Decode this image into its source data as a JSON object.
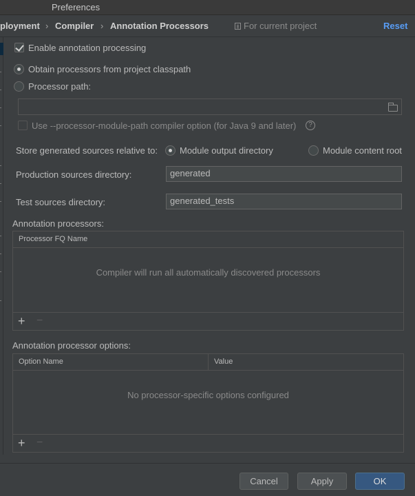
{
  "window": {
    "title": "Preferences"
  },
  "breadcrumb": {
    "items": [
      "ployment",
      "Compiler",
      "Annotation Processors"
    ],
    "scope": "For current project",
    "reset_label": "Reset"
  },
  "form": {
    "enable_processing": {
      "label": "Enable annotation processing",
      "checked": true
    },
    "source": {
      "classpath_label": "Obtain processors from project classpath",
      "classpath_selected": true,
      "path_label": "Processor path:",
      "path_value": ""
    },
    "module_path_option": {
      "label": "Use --processor-module-path compiler option (for Java 9 and later)",
      "checked": false,
      "help": "?"
    },
    "store_relative": {
      "label": "Store generated sources relative to:",
      "options": [
        "Module output directory",
        "Module content root"
      ],
      "selected": "Module output directory"
    },
    "production_dir": {
      "label": "Production sources directory:",
      "value": "generated"
    },
    "test_dir": {
      "label": "Test sources directory:",
      "value": "generated_tests"
    }
  },
  "processors_table": {
    "title": "Annotation processors:",
    "columns": [
      "Processor FQ Name"
    ],
    "empty_text": "Compiler will run all automatically discovered processors",
    "add": "+",
    "remove": "−"
  },
  "options_table": {
    "title": "Annotation processor options:",
    "columns": [
      "Option Name",
      "Value"
    ],
    "empty_text": "No processor-specific options configured",
    "add": "+",
    "remove": "−"
  },
  "buttons": {
    "cancel": "Cancel",
    "apply": "Apply",
    "ok": "OK"
  },
  "colors": {
    "background": "#3c3f41",
    "link": "#589df6",
    "primary_button": "#365880"
  }
}
